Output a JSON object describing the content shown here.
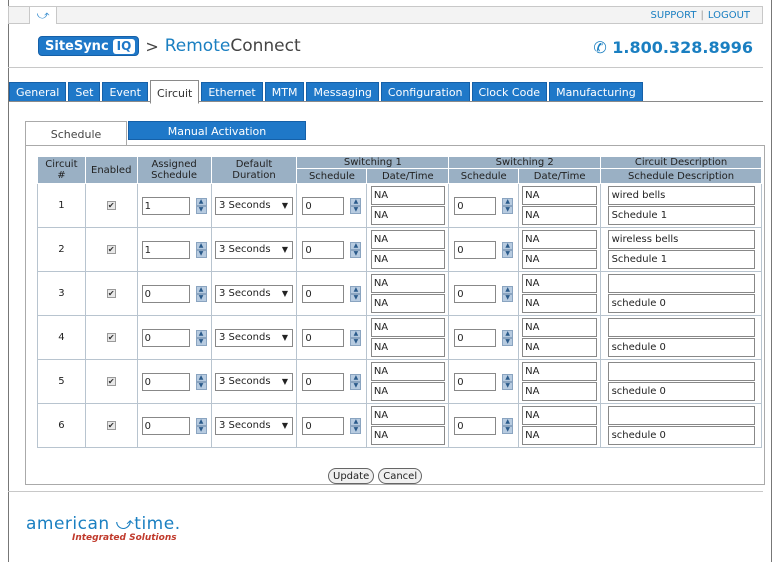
{
  "topbar": {
    "support": "SUPPORT",
    "logout": "LOGOUT",
    "separator": "|"
  },
  "brand": {
    "logo_main": "SiteSync",
    "logo_badge": "IQ",
    "arrow": ">",
    "remote": "Remote",
    "connect": "Connect"
  },
  "phone": "1.800.328.8996",
  "tabs": [
    "General",
    "Set",
    "Event",
    "Circuit",
    "Ethernet",
    "MTM",
    "Messaging",
    "Configuration",
    "Clock Code",
    "Manufacturing"
  ],
  "active_tab": "Circuit",
  "subtabs": {
    "schedule": "Schedule",
    "manual": "Manual Activation"
  },
  "table": {
    "headers": {
      "circuit": "Circuit #",
      "enabled": "Enabled",
      "assigned": "Assigned Schedule",
      "default": "Default Duration",
      "switching1": "Switching 1",
      "switching2": "Switching 2",
      "desc_top": "Circuit Description",
      "sub_schedule": "Schedule",
      "sub_datetime": "Date/Time",
      "desc_bottom": "Schedule Description"
    },
    "rows": [
      {
        "num": "1",
        "assigned": "1",
        "duration": "3 Seconds",
        "s1": "0",
        "s1dt1": "NA",
        "s1dt2": "NA",
        "s2": "0",
        "s2dt1": "NA",
        "s2dt2": "NA",
        "circuit_desc": "wired bells",
        "schedule_desc": "Schedule 1"
      },
      {
        "num": "2",
        "assigned": "1",
        "duration": "3 Seconds",
        "s1": "0",
        "s1dt1": "NA",
        "s1dt2": "NA",
        "s2": "0",
        "s2dt1": "NA",
        "s2dt2": "NA",
        "circuit_desc": "wireless bells",
        "schedule_desc": "Schedule 1"
      },
      {
        "num": "3",
        "assigned": "0",
        "duration": "3 Seconds",
        "s1": "0",
        "s1dt1": "NA",
        "s1dt2": "NA",
        "s2": "0",
        "s2dt1": "NA",
        "s2dt2": "NA",
        "circuit_desc": "",
        "schedule_desc": "schedule 0"
      },
      {
        "num": "4",
        "assigned": "0",
        "duration": "3 Seconds",
        "s1": "0",
        "s1dt1": "NA",
        "s1dt2": "NA",
        "s2": "0",
        "s2dt1": "NA",
        "s2dt2": "NA",
        "circuit_desc": "",
        "schedule_desc": "schedule 0"
      },
      {
        "num": "5",
        "assigned": "0",
        "duration": "3 Seconds",
        "s1": "0",
        "s1dt1": "NA",
        "s1dt2": "NA",
        "s2": "0",
        "s2dt1": "NA",
        "s2dt2": "NA",
        "circuit_desc": "",
        "schedule_desc": "schedule 0"
      },
      {
        "num": "6",
        "assigned": "0",
        "duration": "3 Seconds",
        "s1": "0",
        "s1dt1": "NA",
        "s1dt2": "NA",
        "s2": "0",
        "s2dt1": "NA",
        "s2dt2": "NA",
        "circuit_desc": "",
        "schedule_desc": "schedule 0"
      }
    ]
  },
  "buttons": {
    "update": "Update",
    "cancel": "Cancel"
  },
  "footer": {
    "brand_left": "american",
    "brand_right": "time.",
    "tagline": "Integrated Solutions"
  },
  "colors": {
    "accent": "#1f78c8",
    "header_bg": "#9ab0c4"
  }
}
